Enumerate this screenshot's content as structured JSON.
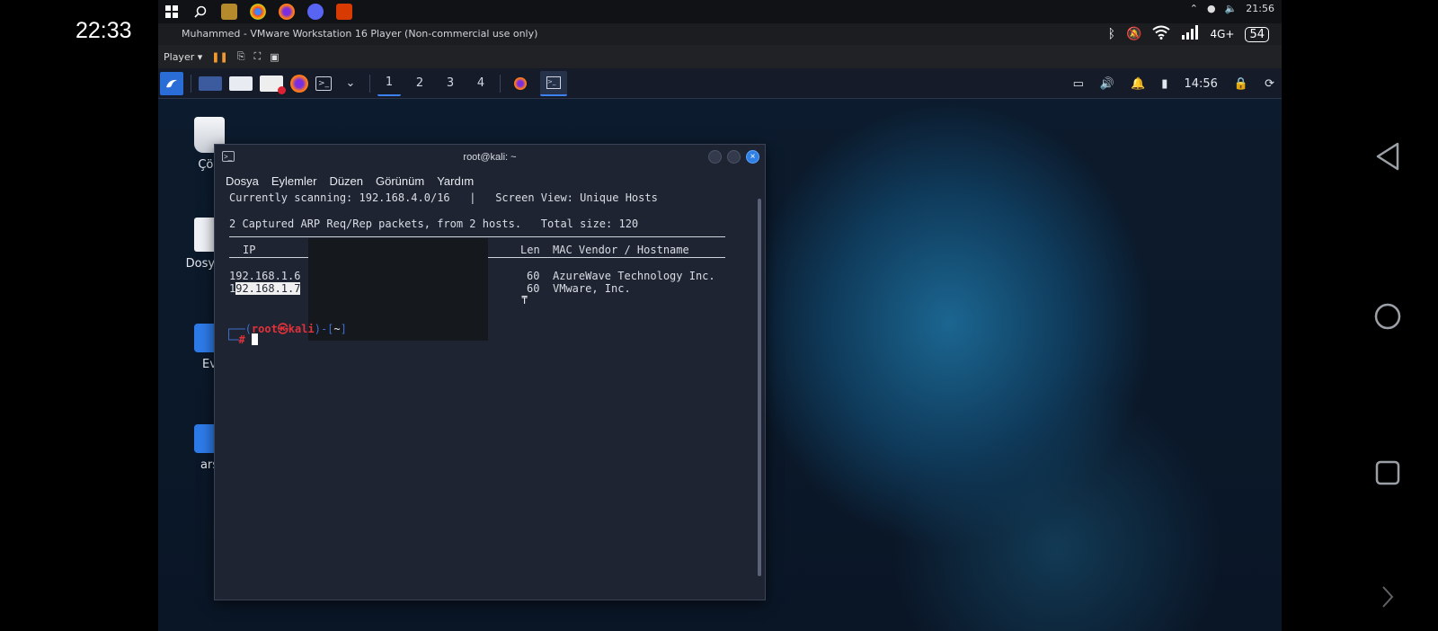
{
  "phone": {
    "clock": "22:33",
    "nav": {
      "back": "back-icon",
      "home": "home-icon",
      "recents": "recents-icon"
    }
  },
  "windows_taskbar": {
    "clock": "21:56",
    "icons": [
      "windows-start-icon",
      "search-icon",
      "vmware-icon",
      "chrome-icon",
      "firefox-icon",
      "discord-icon",
      "office-icon"
    ]
  },
  "vm_window": {
    "title": "Muhammed - VMware Workstation 16 Player (Non-commercial use only)",
    "toolbar": {
      "player_label": "Player"
    }
  },
  "phone_status": {
    "network": "4G+",
    "battery": "54"
  },
  "kali_panel": {
    "workspaces": [
      "1",
      "2",
      "3",
      "4"
    ],
    "clock": "14:56"
  },
  "desktop_icons": [
    {
      "label": "Çöp"
    },
    {
      "label": "Dosya S"
    },
    {
      "label": "Ev"
    },
    {
      "label": "arş"
    }
  ],
  "terminal": {
    "title": "root@kali: ~",
    "menu": [
      "Dosya",
      "Eylemler",
      "Düzen",
      "Görünüm",
      "Yardım"
    ],
    "scan_line": "Currently scanning: 192.168.4.0/16   |   Screen View: Unique Hosts",
    "captured_line": "2 Captured ARP Req/Rep packets, from 2 hosts.   Total size: 120",
    "header_ip": "IP",
    "header_len": "Len",
    "header_vendor": "MAC Vendor / Hostname",
    "rows": [
      {
        "ip": "192.168.1.6",
        "len": "60",
        "vendor": "AzureWave Technology Inc."
      },
      {
        "ip_prefix": "1",
        "ip_selected": "92.168.1.7",
        "len": "60",
        "vendor": "VMware, Inc."
      }
    ],
    "prompt": {
      "bracket_open": "┌──(",
      "user": "root㉿kali",
      "bracket_mid": ")-[",
      "dir": "~",
      "bracket_close": "]",
      "second_line": "└─",
      "hash": "#"
    }
  }
}
